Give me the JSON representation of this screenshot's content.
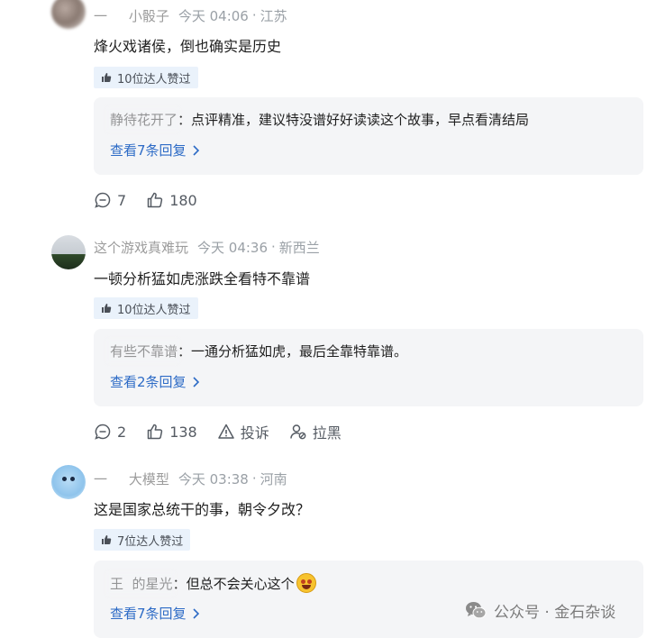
{
  "comments": [
    {
      "username": "一     小骰子",
      "time": "今天 04:06",
      "sep": "·",
      "location": "江苏",
      "text": "烽火戏诸侯，倒也确实是历史",
      "likes_tag": "10位达人赞过",
      "reply": {
        "user": "静待花开了",
        "colon": "：",
        "text": "点评精准，建议特没谱好好读读这个故事，早点看清结局"
      },
      "reply_more": "查看7条回复",
      "actions": {
        "comments": "7",
        "likes": "180"
      }
    },
    {
      "username": "这个游戏真难玩",
      "time": "今天 04:36",
      "sep": "·",
      "location": "新西兰",
      "text": "一顿分析猛如虎涨跌全看特不靠谱",
      "likes_tag": "10位达人赞过",
      "reply": {
        "user": "有些不靠谱",
        "colon": "：",
        "text": "一通分析猛如虎，最后全靠特靠谱。"
      },
      "reply_more": "查看2条回复",
      "actions": {
        "comments": "2",
        "likes": "138",
        "report": "投诉",
        "block": "拉黑"
      }
    },
    {
      "username": "一     大模型",
      "time": "今天 03:38",
      "sep": "·",
      "location": "河南",
      "text": "这是国家总统干的事，朝令夕改？",
      "likes_tag": "7位达人赞过",
      "reply": {
        "user": "王  的星光",
        "colon": "：",
        "text": "但总不会关心这个"
      },
      "reply_more": "查看7条回复"
    }
  ],
  "icons": {
    "thumb": "thumbs-up-icon",
    "comment": "comment-bubble-icon",
    "like": "thumbs-up-outline-icon",
    "report": "warning-triangle-icon",
    "block": "user-block-icon",
    "chevron": "chevron-right-icon",
    "emoji": "grinning-emoji-icon",
    "wechat": "wechat-icon"
  },
  "colors": {
    "link": "#2d6bc6",
    "tag_bg": "#eaf2fb",
    "reply_bg": "#f4f5f7",
    "muted": "#9aa0a6"
  },
  "watermark": {
    "text": "公众号 · 金石杂谈"
  }
}
